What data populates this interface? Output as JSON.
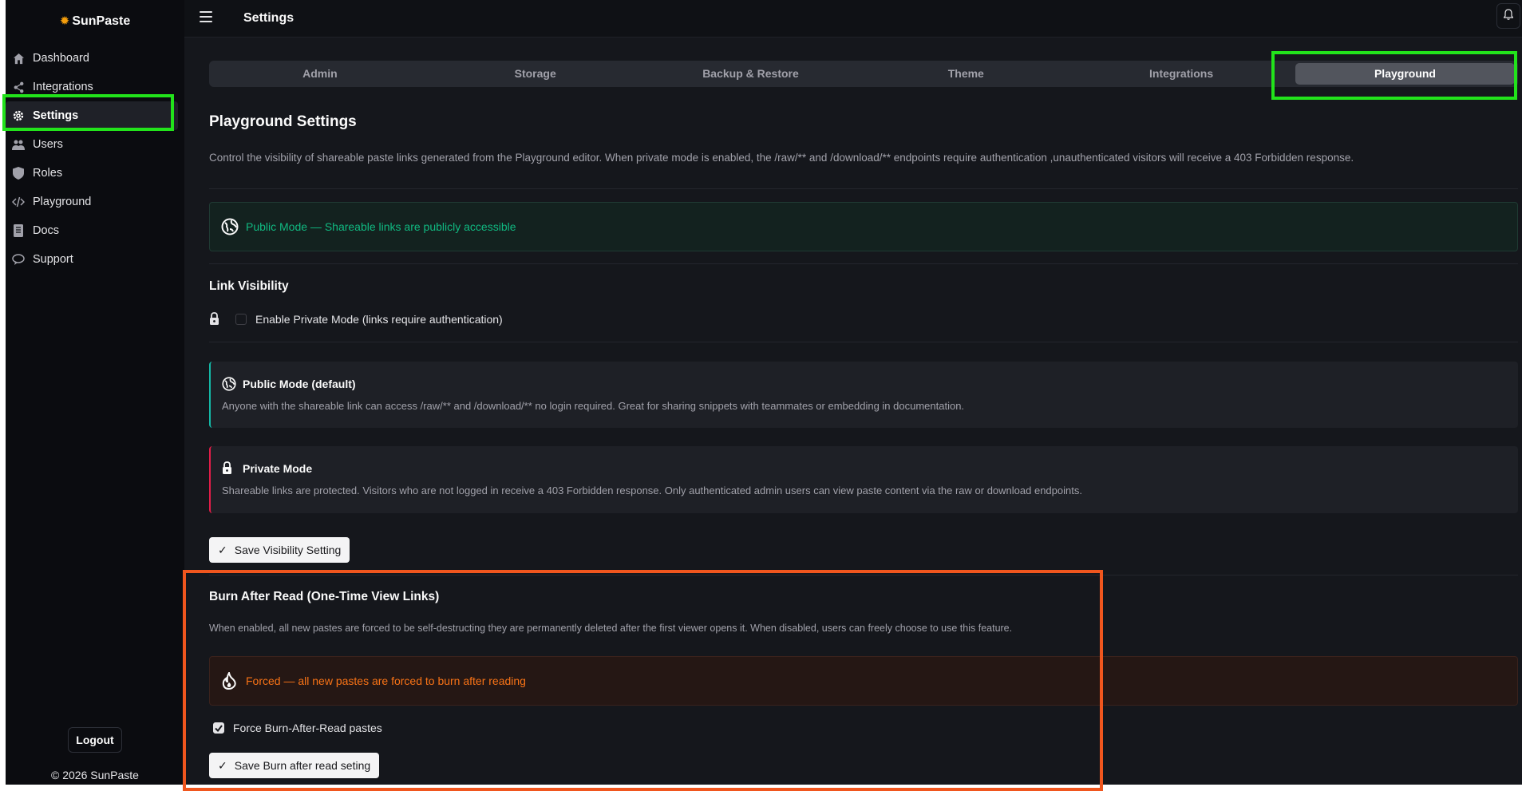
{
  "app": {
    "brand": "SunPaste",
    "copyright": "© 2026 SunPaste",
    "logout_label": "Logout"
  },
  "sidebar": {
    "items": [
      {
        "label": "Dashboard",
        "icon": "home-icon"
      },
      {
        "label": "Integrations",
        "icon": "share-icon"
      },
      {
        "label": "Settings",
        "icon": "gear-icon",
        "active": true
      },
      {
        "label": "Users",
        "icon": "users-icon"
      },
      {
        "label": "Roles",
        "icon": "shield-icon"
      },
      {
        "label": "Playground",
        "icon": "code-icon"
      },
      {
        "label": "Docs",
        "icon": "document-icon"
      },
      {
        "label": "Support",
        "icon": "chat-icon"
      }
    ]
  },
  "topbar": {
    "title": "Settings"
  },
  "tabs": [
    "Admin",
    "Storage",
    "Backup & Restore",
    "Theme",
    "Integrations",
    "Playground"
  ],
  "active_tab": "Playground",
  "playground": {
    "title": "Playground Settings",
    "description": "Control the visibility of shareable paste links generated from the Playground editor. When private mode is enabled, the /raw/** and /download/** endpoints require authentication ,unauthenticated visitors will receive a 403 Forbidden response.",
    "status_banner": "Public Mode — Shareable links are publicly accessible",
    "link_visibility_heading": "Link Visibility",
    "private_mode_checkbox_label": "Enable Private Mode (links require authentication)",
    "private_mode_checked": false,
    "public_card": {
      "title": "Public Mode (default)",
      "text": "Anyone with the shareable link can access /raw/** and /download/** no login required. Great for sharing snippets with teammates or embedding in documentation."
    },
    "private_card": {
      "title": "Private Mode",
      "text": "Shareable links are protected. Visitors who are not logged in receive a 403 Forbidden response. Only authenticated admin users can view paste content via the raw or download endpoints."
    },
    "save_visibility_label": "Save Visibility Setting"
  },
  "burn": {
    "heading": "Burn After Read (One-Time View Links)",
    "description": "When enabled, all new pastes are forced to be self-destructing they are permanently deleted after the first viewer opens it. When disabled, users can freely choose to use this feature.",
    "banner": "Forced — all new pastes are forced to burn after reading",
    "checkbox_label": "Force Burn-After-Read pastes",
    "checkbox_checked": true,
    "save_label": "Save Burn after read seting"
  },
  "colors": {
    "accent_green": "#10b981",
    "accent_orange": "#f97316",
    "highlight_green": "#22e31b",
    "highlight_orange": "#f0561e"
  }
}
